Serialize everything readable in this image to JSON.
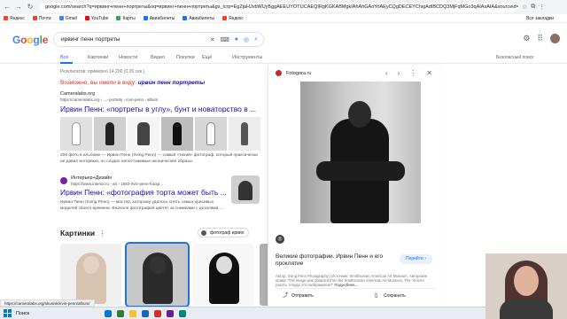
{
  "browser": {
    "url": "google.com/search?q=ирвинг+пенн+портреты&oq=ирвинг+пенн+портреты&gs_lcrp=EgZjaHJvbWUyBggAEEUYOTIJCAEQIRgKGKABMgkIAhAhGAoYoAEyCQgDECEYChigAdIBCDQ3MjFqMGo3qAIAsAIA&sourceid=chrome&ie=UTF-8",
    "back_icon": "←",
    "forward_icon": "→",
    "reload_icon": "↻",
    "bookmarks": [
      {
        "label": "Яндекс",
        "color": "#fc3f1d"
      },
      {
        "label": "Почта",
        "color": "#ea4335"
      },
      {
        "label": "Gmail",
        "color": "#4285f4"
      },
      {
        "label": "YouTube",
        "color": "#ff0000"
      },
      {
        "label": "Карты",
        "color": "#34a853"
      },
      {
        "label": "Авиабилеты",
        "color": "#1a73e8"
      },
      {
        "label": "Авиабилеты",
        "color": "#1a73e8"
      },
      {
        "label": "Яндекс",
        "color": "#fc3f1d"
      }
    ],
    "bookmarks_right": "Все закладки"
  },
  "google": {
    "logo": [
      "G",
      "o",
      "o",
      "g",
      "l",
      "e"
    ],
    "query": "ирвинг пенн портреты",
    "tabs": [
      "Все",
      "Картинки",
      "Новости",
      "Видео",
      "Покупки",
      "Ещё",
      "Инструменты"
    ],
    "safesearch": "Безопасный поиск",
    "stats": "Результатов: примерно 14 200 (0,26 сек.)",
    "did_you_mean_prefix": "Возможно, вы имели в виду:",
    "did_you_mean_query": "ирвин пенн портреты"
  },
  "results": [
    {
      "site": "Cameralabs.org",
      "url": "https://cameralabs.org › ...› portrety › irvin-penn › album",
      "title": "Ирвин Пенн: «портреты в углу», бунт и новаторство в ...",
      "snippet": "206 фото в альбоме — Ирвин Пенн (Irving Penn) — самый «тихий» фотограф, который практически не давал интервью, но создал непостижимые иконические образы."
    },
    {
      "site": "Интерьер+Дизайн",
      "url": "https://www.interior.ru › art › 1683-irvin-penn-fotogr...",
      "title": "Ирвин Пенн: «фотография торта может быть ...",
      "snippet": "Ирвин Пенн (Irving Penn) — мастер, которому удалось снять самых красивых моделей своего времени. Вначале фотография цветет за снимками с деталями, ..."
    }
  ],
  "images_section": {
    "heading": "Картинки",
    "more_icon": "⋮",
    "chip": "фотограф ирвин"
  },
  "panel": {
    "source": "Fotogora.ru",
    "title": "Великие фотографии. Ирвин Пенн и его проклятие",
    "visit_label": "Перейти ›",
    "description": "Автор: Irving Penn Photography | Источник: Smithsonian American Art Museum. Авторские права: This image was obtained from the Smithsonian American Art Museum. The 'Хотите узнать, откуда это изображение?'",
    "description_link": "Подробнее...",
    "share_label": "Отправить",
    "save_label": "Сохранить"
  },
  "status_url": "https://cameralabs.org/skusnik/irvin-penn/album/",
  "taskbar": {
    "search_label": "Поиск",
    "apps": [
      "#0078d4",
      "#2e7d32",
      "#fbc02d",
      "#1565c0",
      "#d32f2f",
      "#6a1b9a",
      "#00897b"
    ]
  }
}
